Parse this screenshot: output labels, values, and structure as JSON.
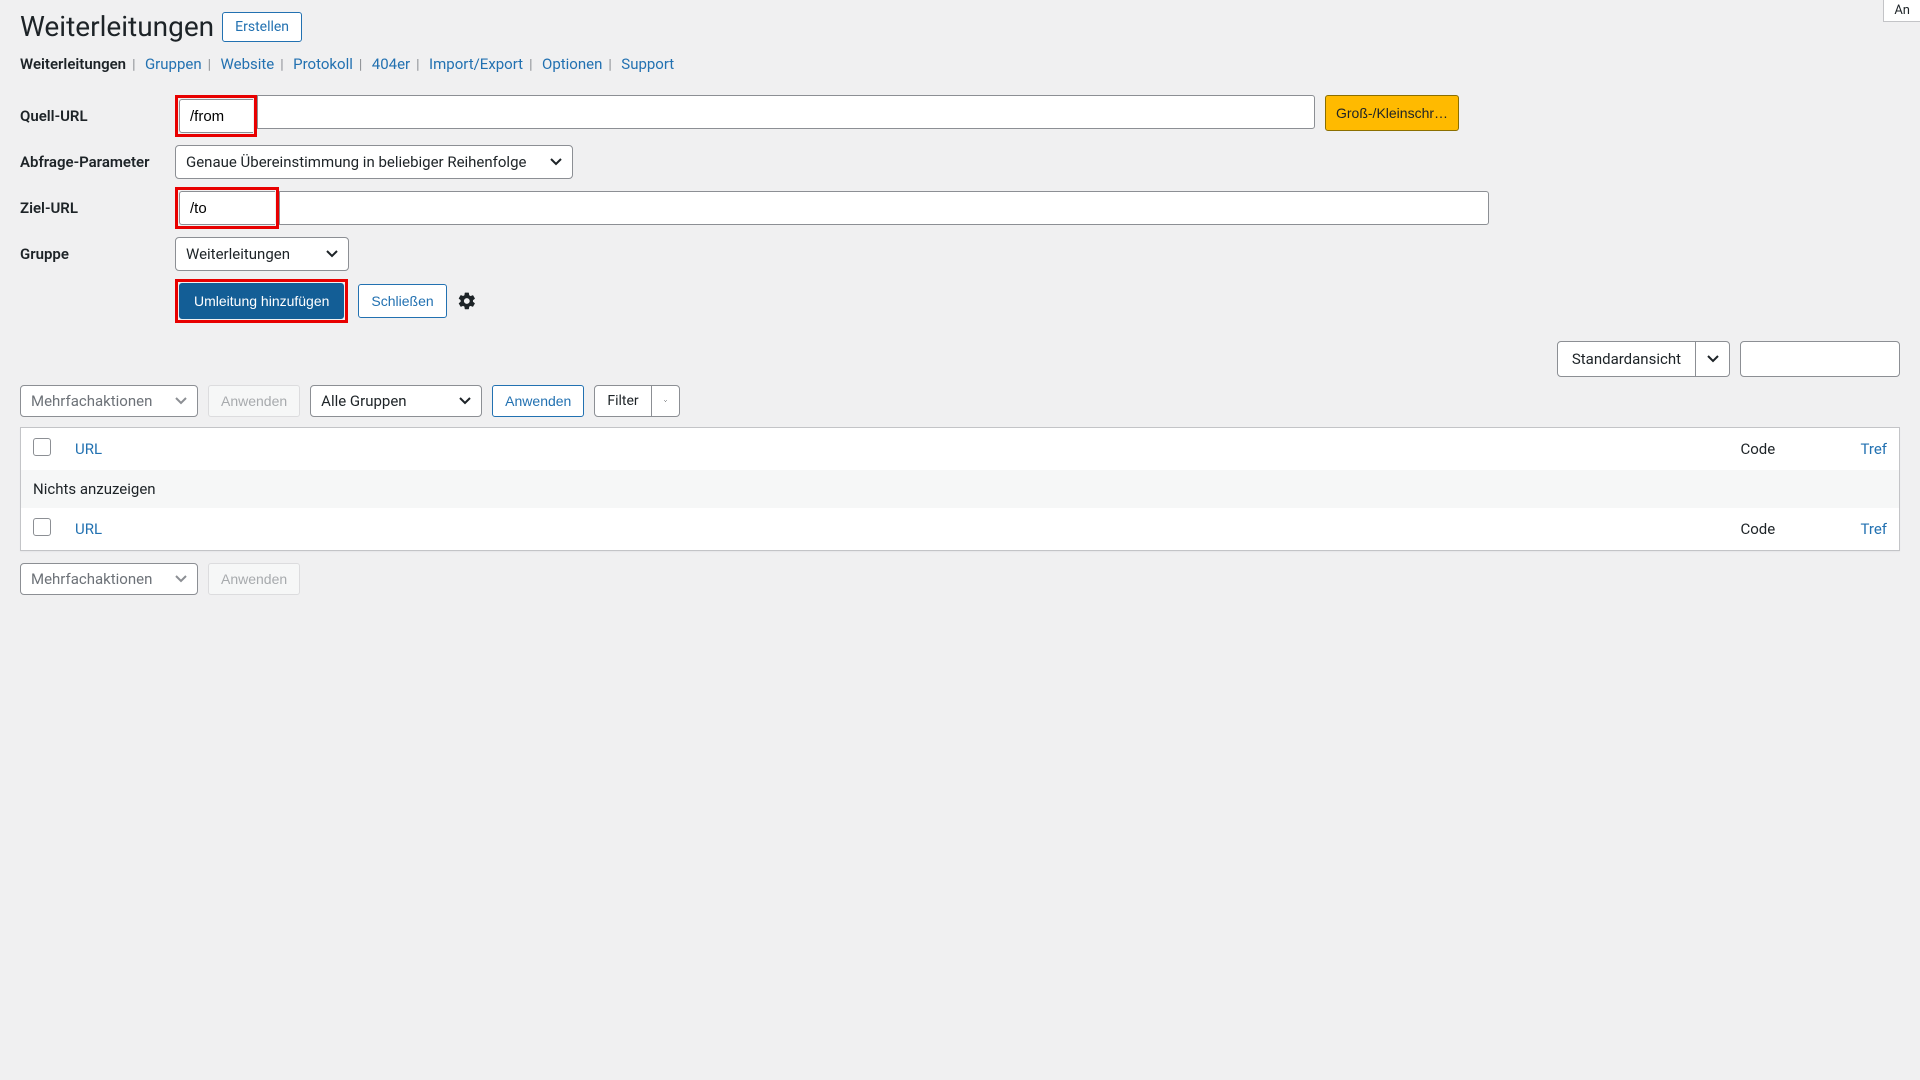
{
  "page": {
    "title": "Weiterleitungen",
    "create_button": "Erstellen",
    "top_right": "An"
  },
  "tabs": {
    "items": [
      "Weiterleitungen",
      "Gruppen",
      "Website",
      "Protokoll",
      "404er",
      "Import/Export",
      "Optionen",
      "Support"
    ],
    "active_index": 0
  },
  "form": {
    "source_label": "Quell-URL",
    "source_value": "/from",
    "case_toggle": "Groß-/Kleinschr…",
    "query_label": "Abfrage-Parameter",
    "query_value": "Genaue Übereinstimmung in beliebiger Reihenfolge",
    "target_label": "Ziel-URL",
    "target_value": "/to",
    "group_label": "Gruppe",
    "group_value": "Weiterleitungen",
    "submit": "Umleitung hinzufügen",
    "close": "Schließen"
  },
  "view": {
    "label": "Standardansicht"
  },
  "bulk": {
    "actions_label": "Mehrfachaktionen",
    "apply": "Anwenden",
    "group_filter": "Alle Gruppen",
    "apply2": "Anwenden",
    "filter": "Filter"
  },
  "table": {
    "col_url": "URL",
    "col_code": "Code",
    "col_hits": "Tref",
    "empty": "Nichts anzuzeigen"
  }
}
